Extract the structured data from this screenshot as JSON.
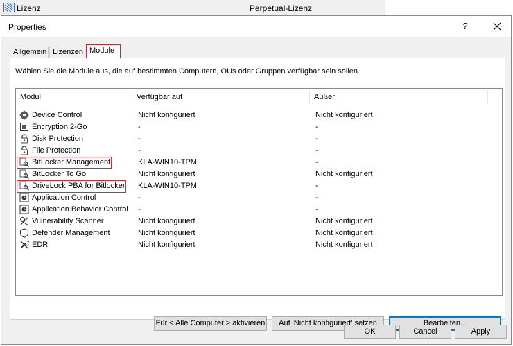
{
  "background_row": {
    "name": "Lizenz",
    "value": "Perpetual-Lizenz"
  },
  "dialog": {
    "title": "Properties",
    "help": "?",
    "tabs": [
      {
        "label": "Allgemein"
      },
      {
        "label": "Lizenzen"
      },
      {
        "label": "Module",
        "active": true
      }
    ],
    "instruction": "Wählen Sie die Module aus, die auf bestimmten Computern, OUs oder Gruppen verfügbar sein sollen.",
    "table": {
      "columns": [
        "Modul",
        "Verfügbar auf",
        "Außer"
      ],
      "rows": [
        {
          "icon": "gear-icon",
          "module": "Device Control",
          "available": "Nicht konfiguriert",
          "except": "Nicht konfiguriert"
        },
        {
          "icon": "encryption-icon",
          "module": "Encryption 2-Go",
          "available": "-",
          "except": "-"
        },
        {
          "icon": "lock-icon",
          "module": "Disk Protection",
          "available": "-",
          "except": "-"
        },
        {
          "icon": "lock-icon",
          "module": "File Protection",
          "available": "-",
          "except": "-"
        },
        {
          "icon": "key-icon",
          "module": "BitLocker Management",
          "available": "KLA-WIN10-TPM",
          "except": "-",
          "highlighted": true
        },
        {
          "icon": "key-icon",
          "module": "BitLocker To Go",
          "available": "Nicht konfiguriert",
          "except": "Nicht konfiguriert"
        },
        {
          "icon": "key-icon",
          "module": "DriveLock PBA for Bitlocker",
          "available": "KLA-WIN10-TPM",
          "except": "-",
          "highlighted": true
        },
        {
          "icon": "app-control-icon",
          "module": "Application Control",
          "available": "-",
          "except": "-"
        },
        {
          "icon": "app-control-icon",
          "module": "Application Behavior Control",
          "available": "-",
          "except": "-"
        },
        {
          "icon": "scanner-icon",
          "module": "Vulnerability Scanner",
          "available": "Nicht konfiguriert",
          "except": "Nicht konfiguriert"
        },
        {
          "icon": "shield-icon",
          "module": "Defender Management",
          "available": "Nicht konfiguriert",
          "except": "Nicht konfiguriert"
        },
        {
          "icon": "tools-icon",
          "module": "EDR",
          "available": "Nicht konfiguriert",
          "except": "Nicht konfiguriert"
        }
      ]
    },
    "panel_buttons": {
      "activate_all": "Für < Alle Computer > aktivieren",
      "set_not_configured": "Auf 'Nicht konfiguriert' setzen",
      "edit": "Bearbeiten..."
    },
    "footer_buttons": {
      "ok": "OK",
      "cancel": "Cancel",
      "apply": "Apply"
    }
  },
  "colors": {
    "highlight": "#e3222b",
    "accent": "#0078d7"
  }
}
